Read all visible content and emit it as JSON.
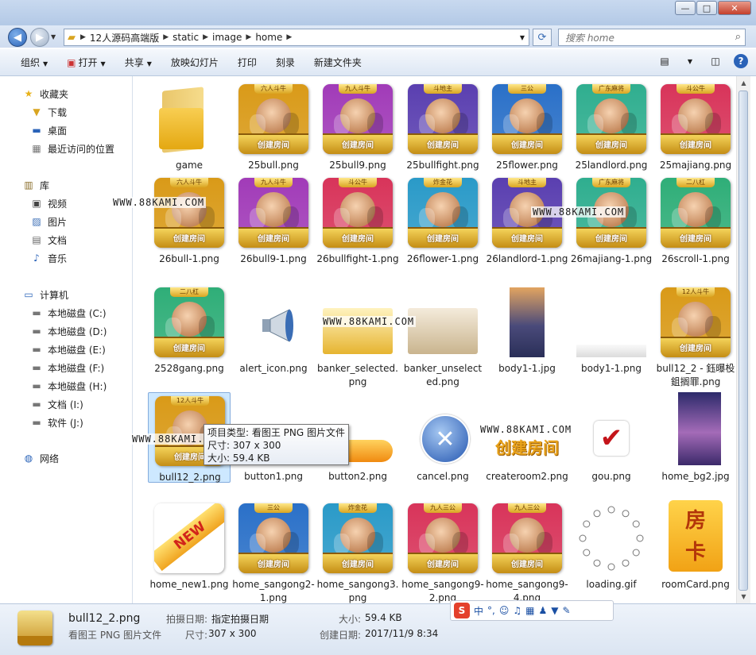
{
  "window": {
    "minimize": "—",
    "maximize": "□",
    "close": "✕"
  },
  "address": {
    "crumbs": [
      "12人源码高端版",
      "static",
      "image",
      "home"
    ]
  },
  "search": {
    "placeholder": "搜索 home"
  },
  "toolbar": {
    "organize": "组织",
    "open": "打开",
    "share": "共享",
    "slideshow": "放映幻灯片",
    "print": "打印",
    "burn": "刻录",
    "new_folder": "新建文件夹"
  },
  "sidebar": {
    "favorites": "收藏夹",
    "downloads": "下载",
    "desktop": "桌面",
    "recent": "最近访问的位置",
    "libraries": "库",
    "videos": "视频",
    "pictures": "图片",
    "documents": "文档",
    "music": "音乐",
    "computer": "计算机",
    "drive_c": "本地磁盘 (C:)",
    "drive_d": "本地磁盘 (D:)",
    "drive_e": "本地磁盘 (E:)",
    "drive_f": "本地磁盘 (F:)",
    "drive_h": "本地磁盘 (H:)",
    "drive_i": "文档 (I:)",
    "drive_j": "软件 (J:)",
    "network": "网络"
  },
  "files": [
    {
      "name": "game",
      "kind": "folder"
    },
    {
      "name": "25bull.png",
      "kind": "card",
      "ribbon": "六人斗牛",
      "color": "#d99a18"
    },
    {
      "name": "25bull9.png",
      "kind": "card",
      "ribbon": "九人斗牛",
      "color": "#a13bb8"
    },
    {
      "name": "25bullfight.png",
      "kind": "card",
      "ribbon": "斗地主",
      "color": "#5a3fb0"
    },
    {
      "name": "25flower.png",
      "kind": "card",
      "ribbon": "三公",
      "color": "#2a70c8"
    },
    {
      "name": "25landlord.png",
      "kind": "card",
      "ribbon": "广东麻将",
      "color": "#2fae8f"
    },
    {
      "name": "25majiang.png",
      "kind": "card",
      "ribbon": "斗公牛",
      "color": "#d8345a"
    },
    {
      "name": "26bull-1.png",
      "kind": "card",
      "ribbon": "六人斗牛",
      "color": "#d99a18"
    },
    {
      "name": "26bull9-1.png",
      "kind": "card",
      "ribbon": "九人斗牛",
      "color": "#a13bb8"
    },
    {
      "name": "26bullfight-1.png",
      "kind": "card",
      "ribbon": "斗公牛",
      "color": "#d8345a"
    },
    {
      "name": "26flower-1.png",
      "kind": "card",
      "ribbon": "炸金花",
      "color": "#2a9ac8"
    },
    {
      "name": "26landlord-1.png",
      "kind": "card",
      "ribbon": "斗地主",
      "color": "#5a3fb0"
    },
    {
      "name": "26majiang-1.png",
      "kind": "card",
      "ribbon": "广东麻将",
      "color": "#2fae8f"
    },
    {
      "name": "26scroll-1.png",
      "kind": "card",
      "ribbon": "二八杠",
      "color": "#2fae78"
    },
    {
      "name": "2528gang.png",
      "kind": "card",
      "ribbon": "二八杠",
      "color": "#2fae78"
    },
    {
      "name": "alert_icon.png",
      "kind": "megaphone"
    },
    {
      "name": "banker_selected.png",
      "kind": "gold"
    },
    {
      "name": "banker_unselected.png",
      "kind": "beige"
    },
    {
      "name": "body1-1.jpg",
      "kind": "tall"
    },
    {
      "name": "body1-1.png",
      "kind": "thinbar"
    },
    {
      "name": "bull12_2 - 鈺曝杸鉏搁罪.png",
      "kind": "card",
      "ribbon": "12人斗牛",
      "color": "#d99a18"
    },
    {
      "name": "bull12_2.png",
      "kind": "card",
      "ribbon": "12人斗牛",
      "color": "#d99a18"
    },
    {
      "name": "button1.png",
      "kind": "orangebtn"
    },
    {
      "name": "button2.png",
      "kind": "orangebtn"
    },
    {
      "name": "cancel.png",
      "kind": "cancel"
    },
    {
      "name": "createroom2.png",
      "kind": "createtext",
      "text": "创建房间"
    },
    {
      "name": "gou.png",
      "kind": "check"
    },
    {
      "name": "home_bg2.jpg",
      "kind": "bg2"
    },
    {
      "name": "home_new1.png",
      "kind": "newtag",
      "text": "NEW"
    },
    {
      "name": "home_sangong2-1.png",
      "kind": "card",
      "ribbon": "三公",
      "color": "#2a70c8"
    },
    {
      "name": "home_sangong3.png",
      "kind": "card",
      "ribbon": "炸金花",
      "color": "#2a9ac8"
    },
    {
      "name": "home_sangong9-2.png",
      "kind": "card",
      "ribbon": "九人三公",
      "color": "#d8345a"
    },
    {
      "name": "home_sangong9-4.png",
      "kind": "card",
      "ribbon": "九人三公",
      "color": "#d8345a"
    },
    {
      "name": "loading.gif",
      "kind": "loading"
    },
    {
      "name": "roomCard.png",
      "kind": "roomcard",
      "text": "房卡"
    }
  ],
  "card_button_text": "创建房间",
  "tooltip": {
    "line1": "项目类型: 看图王 PNG 图片文件",
    "line2": "尺寸: 307 x 300",
    "line3": "大小: 59.4 KB"
  },
  "watermark": "WWW.88KAMI.COM",
  "details": {
    "name": "bull12_2.png",
    "type": "看图王 PNG 图片文件",
    "taken_label": "拍摄日期:",
    "taken_value": "指定拍摄日期",
    "dim_label": "尺寸:",
    "dim_value": "307 x 300",
    "size_label": "大小:",
    "size_value": "59.4 KB",
    "created_label": "创建日期:",
    "created_value": "2017/11/9 8:34"
  },
  "ime": {
    "logo": "S",
    "mode": "中"
  },
  "colors": {
    "accent": "#3a6db5",
    "selection": "#cde8ff"
  }
}
